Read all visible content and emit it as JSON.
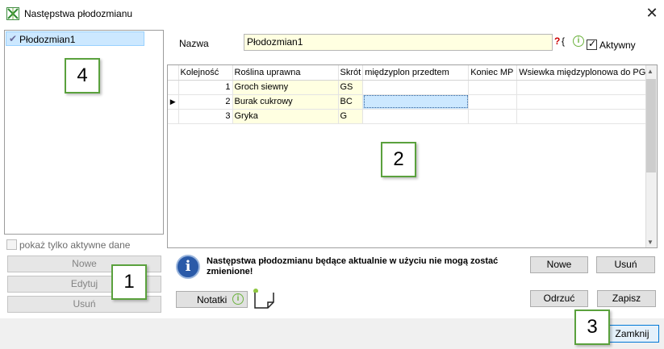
{
  "window": {
    "title": "Następstwa płodozmianu",
    "close_glyph": "✕"
  },
  "left": {
    "items": [
      {
        "label": "Płodozmian1",
        "selected": true,
        "active": true
      }
    ],
    "active_only_label": "pokaż tylko aktywne dane",
    "buttons": {
      "new": "Nowe",
      "edit": "Edytuj",
      "delete": "Usuń"
    }
  },
  "form": {
    "name_label": "Nazwa",
    "name_value": "Płodozmian1",
    "active_label": "Aktywny",
    "active_checked": true
  },
  "grid": {
    "columns": [
      "Kolejność",
      "Roślina uprawna",
      "Skrót",
      "międzyplon przedtem",
      "Koniec MP",
      "Wsiewka międzyplonowa do PG"
    ],
    "rows": [
      [
        "1",
        "Groch siewny",
        "GS",
        "",
        "",
        ""
      ],
      [
        "2",
        "Burak cukrowy",
        "BC",
        "",
        "",
        ""
      ],
      [
        "3",
        "Gryka",
        "G",
        "",
        "",
        ""
      ]
    ],
    "current_row_index": 1,
    "current_row_marker": "▶"
  },
  "message": {
    "text": "Następstwa płodozmianu będące aktualnie w użyciu nie mogą zostać zmienione!"
  },
  "actions": {
    "new": "Nowe",
    "delete": "Usuń",
    "notes": "Notatki",
    "discard": "Odrzuć",
    "save": "Zapisz",
    "close": "Zamknij"
  },
  "callouts": [
    "1",
    "2",
    "3",
    "4"
  ],
  "colors": {
    "selection": "#cce8ff",
    "required_field_bg": "#ffffe1",
    "callout_border": "#5aa13d",
    "info_blue": "#2a5aa8"
  }
}
